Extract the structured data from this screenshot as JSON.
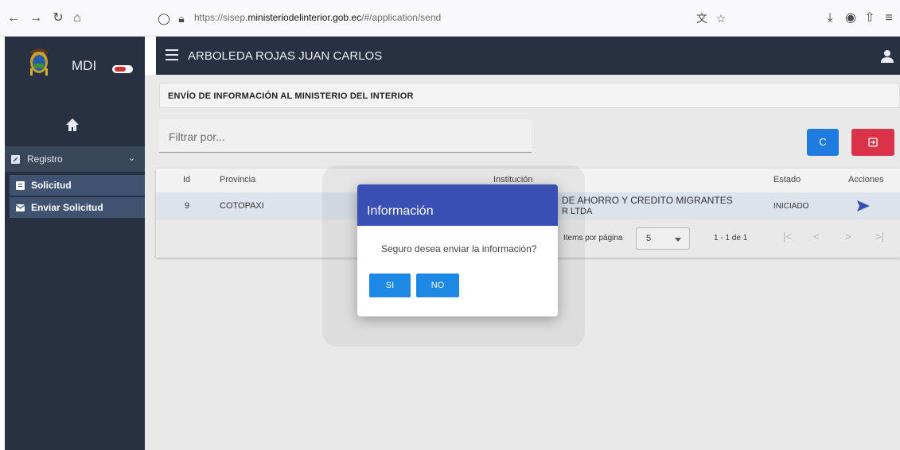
{
  "browser": {
    "url_prefix": "https://sisep.",
    "url_host": "ministeriodelinterior.gob.ec",
    "url_suffix": "/#/application/send"
  },
  "sidebar": {
    "brand": "MDI",
    "group_label": "Registro",
    "items": [
      {
        "label": "Solicitud"
      },
      {
        "label": "Enviar Solicitud"
      }
    ]
  },
  "header": {
    "user_name": "ARBOLEDA ROJAS JUAN CARLOS"
  },
  "main": {
    "section_title": "ENVÍO DE INFORMACIÓN AL MINISTERIO DEL INTERIOR",
    "filter_placeholder": "Filtrar por...",
    "refresh_glyph": "C"
  },
  "table": {
    "columns": [
      "Id",
      "Provincia",
      "Institución",
      "Estado",
      "Acciones"
    ],
    "row": {
      "id": "9",
      "provincia": "COTOPAXI",
      "institucion_line1": "DE AHORRO Y CREDITO MIGRANTES",
      "institucion_line2": "R LTDA",
      "estado": "INICIADO"
    },
    "paginator": {
      "items_label": "Items por página",
      "page_size": "5",
      "range": "1 - 1 de 1"
    }
  },
  "dialog": {
    "title": "Información",
    "message": "Seguro desea enviar la información?",
    "yes_label": "SI",
    "no_label": "NO"
  },
  "colors": {
    "sidebar_bg": "#283141",
    "dialog_header": "#3a4fb3",
    "primary_button": "#1e88e5",
    "refresh_button": "#1e7be0",
    "exit_button": "#d93249",
    "send_icon": "#3a4fb3"
  }
}
